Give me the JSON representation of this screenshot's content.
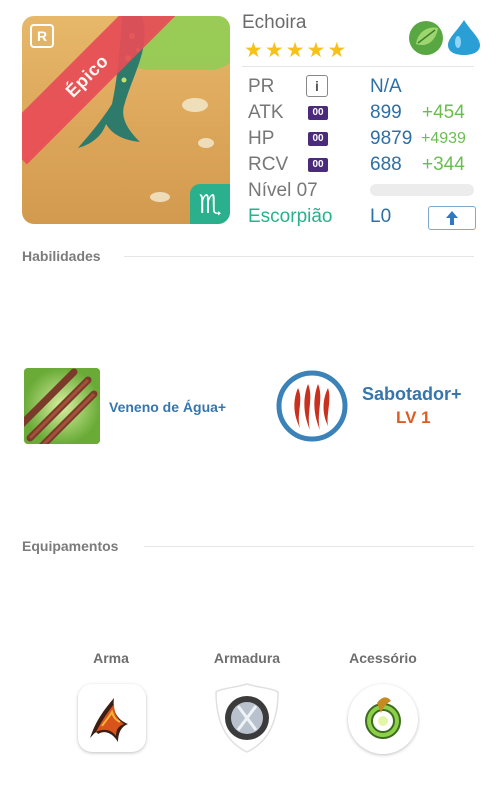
{
  "monster": {
    "name": "Echoira",
    "rarity_ribbon": "Épico",
    "rank_badge": "R",
    "star_count": 5,
    "zodiac_symbol": "♏",
    "elements": [
      "leaf-element-icon",
      "water-element-icon"
    ]
  },
  "stats": {
    "pr": {
      "label": "PR",
      "value": "N/A"
    },
    "atk": {
      "label": "ATK",
      "badge": "00",
      "value": "899",
      "bonus": "+454"
    },
    "hp": {
      "label": "HP",
      "badge": "00",
      "value": "9879",
      "bonus": "+4939"
    },
    "rcv": {
      "label": "RCV",
      "badge": "00",
      "value": "688",
      "bonus": "+344"
    },
    "level": {
      "label": "Nível 07",
      "progress": 0
    },
    "zodiac": {
      "label": "Escorpião",
      "value": "L0"
    }
  },
  "sections": {
    "skills": "Habilidades",
    "equipment": "Equipamentos"
  },
  "skills": {
    "skill1": {
      "name": "Veneno de Água+"
    },
    "skill2": {
      "name": "Sabotador+",
      "level": "LV 1"
    }
  },
  "equipment": {
    "weapon": "Arma",
    "armor": "Armadura",
    "accessory": "Acessório"
  },
  "colors": {
    "accent_blue": "#2f6fa4",
    "bonus_green": "#6abe4f",
    "zodiac_teal": "#2bb08e",
    "ribbon_red": "#e84c57",
    "star_gold": "#f6c21a",
    "level_orange": "#e05b22"
  }
}
